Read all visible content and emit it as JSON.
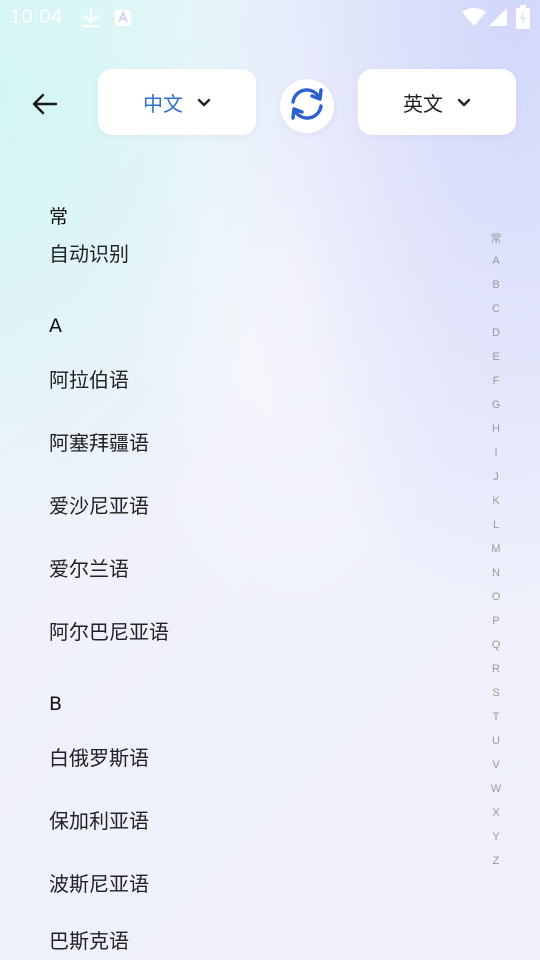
{
  "status_bar": {
    "time": "10:04"
  },
  "header": {
    "source_language": "中文",
    "target_language": "英文"
  },
  "sections": [
    {
      "header": "常",
      "items": [
        "自动识别"
      ]
    },
    {
      "header": "A",
      "items": [
        "阿拉伯语",
        "阿塞拜疆语",
        "爱沙尼亚语",
        "爱尔兰语",
        "阿尔巴尼亚语"
      ]
    },
    {
      "header": "B",
      "items": [
        "白俄罗斯语",
        "保加利亚语",
        "波斯尼亚语",
        "巴斯克语"
      ]
    }
  ],
  "index_bar": [
    "常",
    "A",
    "B",
    "C",
    "D",
    "E",
    "F",
    "G",
    "H",
    "I",
    "J",
    "K",
    "L",
    "M",
    "N",
    "O",
    "P",
    "Q",
    "R",
    "S",
    "T",
    "U",
    "V",
    "W",
    "X",
    "Y",
    "Z"
  ],
  "colors": {
    "accent": "#2f6fd6",
    "swap_icon": "#2d5fd0"
  },
  "icons": {
    "back": "arrow-left-icon",
    "dropdown": "chevron-down-icon",
    "swap": "swap-icon"
  }
}
